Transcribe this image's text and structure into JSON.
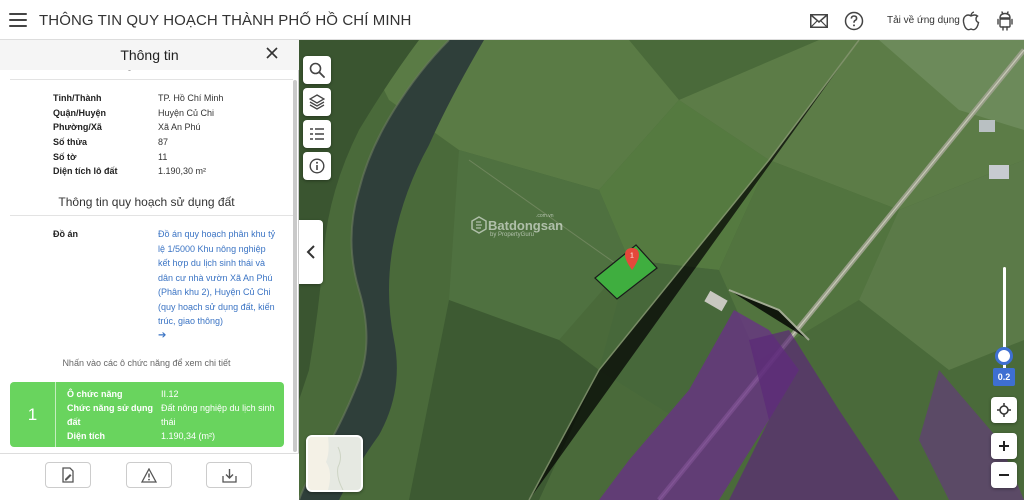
{
  "header": {
    "title": "THÔNG TIN QUY HOẠCH THÀNH PHỐ HỒ CHÍ MINH",
    "download_label": "Tải về ứng dụng",
    "icons": [
      "menu-icon",
      "mail-icon",
      "help-icon",
      "apple-icon",
      "android-icon"
    ]
  },
  "panel": {
    "title": "Thông tin",
    "cut_heading": "Thông tin thửa đất",
    "parcel_info": [
      {
        "label": "Tỉnh/Thành",
        "value": "TP. Hồ Chí Minh"
      },
      {
        "label": "Quận/Huyện",
        "value": "Huyện Củ Chi"
      },
      {
        "label": "Phường/Xã",
        "value": "Xã An Phú"
      },
      {
        "label": "Số thửa",
        "value": "87"
      },
      {
        "label": "Số tờ",
        "value": "11"
      },
      {
        "label": "Diện tích lô đất",
        "value": "1.190,30 m²"
      }
    ],
    "section_title": "Thông tin quy hoạch sử dụng đất",
    "doan_label": "Đồ án",
    "doan_text": "Đồ án quy hoạch phân khu tỷ lệ 1/5000 Khu nông nghiệp kết hợp du lịch sinh thái và dân cư nhà vườn Xã An Phú (Phân khu 2), Huyện Củ Chi (quy hoạch sử dụng đất, kiến trúc, giao thông)",
    "doan_arrow": "➔",
    "hint": "Nhấn vào các ô chức năng để xem chi tiết",
    "function_card": {
      "number": "1",
      "rows": [
        {
          "label": "Ô chức năng",
          "value": "II.12"
        },
        {
          "label": "Chức năng sử dụng đất",
          "value": "Đất nông nghiệp du lịch sinh thái"
        },
        {
          "label": "Diện tích",
          "value": "1.190,34 (m²)"
        }
      ],
      "color": "#69d45e"
    },
    "footer_icons": [
      "edit-document-icon",
      "warning-icon",
      "download-icon"
    ]
  },
  "map": {
    "watermark": "Batdongsan",
    "watermark_sub": "by PropertyGuru",
    "watermark_cv": ".com.vn",
    "marker_label": "1",
    "zoom_value": "0.2",
    "zoom_level": 0.2,
    "tools": [
      "search-icon",
      "layers-icon",
      "legend-icon",
      "info-icon"
    ],
    "colors": {
      "parcel": "#3fae3f",
      "zone": "#6a2f8a",
      "marker": "#e5483b",
      "accent": "#3e6fd2"
    }
  }
}
